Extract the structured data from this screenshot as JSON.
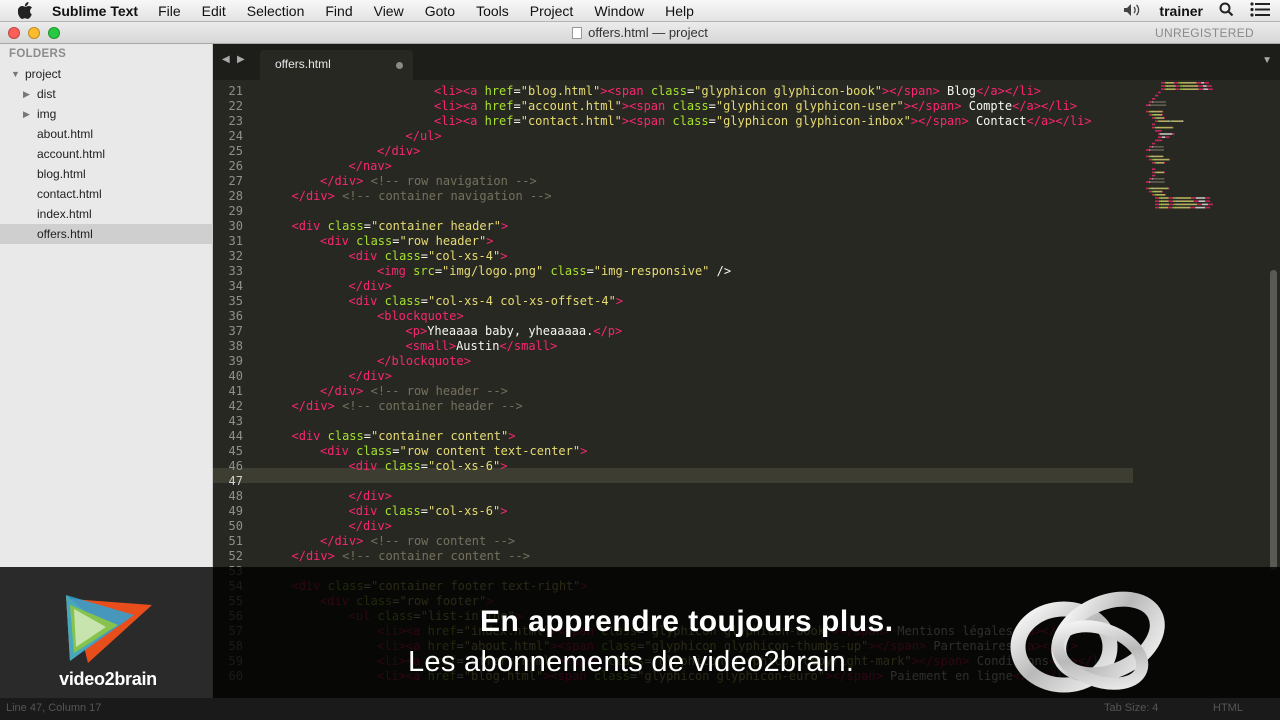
{
  "menubar": {
    "app_name": "Sublime Text",
    "items": [
      "File",
      "Edit",
      "Selection",
      "Find",
      "View",
      "Goto",
      "Tools",
      "Project",
      "Window",
      "Help"
    ],
    "user": "trainer"
  },
  "window": {
    "title": "offers.html — project",
    "registration": "UNREGISTERED"
  },
  "sidebar": {
    "header": "FOLDERS",
    "project": "project",
    "folders": [
      "dist",
      "img"
    ],
    "files": [
      "about.html",
      "account.html",
      "blog.html",
      "contact.html",
      "index.html",
      "offers.html"
    ],
    "selected": "offers.html"
  },
  "tab": {
    "label": "offers.html",
    "modified": true
  },
  "editor": {
    "current_line": 47,
    "lines": [
      {
        "n": 21,
        "indent": 6,
        "p": [
          [
            "t",
            "<li>"
          ],
          [
            "t",
            "<a "
          ],
          [
            "a",
            "href"
          ],
          [
            "p",
            "="
          ],
          [
            "s",
            "\"blog.html\""
          ],
          [
            "t",
            ">"
          ],
          [
            "t",
            "<span "
          ],
          [
            "a",
            "class"
          ],
          [
            "p",
            "="
          ],
          [
            "s",
            "\"glyphicon glyphicon-book\""
          ],
          [
            "t",
            ">"
          ],
          [
            "t",
            "</span>"
          ],
          [
            "p",
            " Blog"
          ],
          [
            "t",
            "</a>"
          ],
          [
            "t",
            "</li>"
          ]
        ]
      },
      {
        "n": 22,
        "indent": 6,
        "p": [
          [
            "t",
            "<li>"
          ],
          [
            "t",
            "<a "
          ],
          [
            "a",
            "href"
          ],
          [
            "p",
            "="
          ],
          [
            "s",
            "\"account.html\""
          ],
          [
            "t",
            ">"
          ],
          [
            "t",
            "<span "
          ],
          [
            "a",
            "class"
          ],
          [
            "p",
            "="
          ],
          [
            "s",
            "\"glyphicon glyphicon-user\""
          ],
          [
            "t",
            ">"
          ],
          [
            "t",
            "</span>"
          ],
          [
            "p",
            " Compte"
          ],
          [
            "t",
            "</a>"
          ],
          [
            "t",
            "</li>"
          ]
        ]
      },
      {
        "n": 23,
        "indent": 6,
        "p": [
          [
            "t",
            "<li>"
          ],
          [
            "t",
            "<a "
          ],
          [
            "a",
            "href"
          ],
          [
            "p",
            "="
          ],
          [
            "s",
            "\"contact.html\""
          ],
          [
            "t",
            ">"
          ],
          [
            "t",
            "<span "
          ],
          [
            "a",
            "class"
          ],
          [
            "p",
            "="
          ],
          [
            "s",
            "\"glyphicon glyphicon-inbox\""
          ],
          [
            "t",
            ">"
          ],
          [
            "t",
            "</span>"
          ],
          [
            "p",
            " Contact"
          ],
          [
            "t",
            "</a>"
          ],
          [
            "t",
            "</li>"
          ]
        ]
      },
      {
        "n": 24,
        "indent": 5,
        "p": [
          [
            "t",
            "</ul>"
          ]
        ]
      },
      {
        "n": 25,
        "indent": 4,
        "p": [
          [
            "t",
            "</div>"
          ]
        ]
      },
      {
        "n": 26,
        "indent": 3,
        "p": [
          [
            "t",
            "</nav>"
          ]
        ]
      },
      {
        "n": 27,
        "indent": 2,
        "p": [
          [
            "t",
            "</div>"
          ],
          [
            "p",
            " "
          ],
          [
            "c",
            "<!-- row navigation -->"
          ]
        ]
      },
      {
        "n": 28,
        "indent": 1,
        "p": [
          [
            "t",
            "</div>"
          ],
          [
            "p",
            " "
          ],
          [
            "c",
            "<!-- container navigation -->"
          ]
        ]
      },
      {
        "n": 29,
        "indent": 0,
        "p": []
      },
      {
        "n": 30,
        "indent": 1,
        "p": [
          [
            "t",
            "<div "
          ],
          [
            "a",
            "class"
          ],
          [
            "p",
            "="
          ],
          [
            "s",
            "\"container header\""
          ],
          [
            "t",
            ">"
          ]
        ]
      },
      {
        "n": 31,
        "indent": 2,
        "p": [
          [
            "t",
            "<div "
          ],
          [
            "a",
            "class"
          ],
          [
            "p",
            "="
          ],
          [
            "s",
            "\"row header\""
          ],
          [
            "t",
            ">"
          ]
        ]
      },
      {
        "n": 32,
        "indent": 3,
        "p": [
          [
            "t",
            "<div "
          ],
          [
            "a",
            "class"
          ],
          [
            "p",
            "="
          ],
          [
            "s",
            "\"col-xs-4\""
          ],
          [
            "t",
            ">"
          ]
        ]
      },
      {
        "n": 33,
        "indent": 4,
        "p": [
          [
            "t",
            "<img "
          ],
          [
            "a",
            "src"
          ],
          [
            "p",
            "="
          ],
          [
            "s",
            "\"img/logo.png\""
          ],
          [
            "p",
            " "
          ],
          [
            "a",
            "class"
          ],
          [
            "p",
            "="
          ],
          [
            "s",
            "\"img-responsive\""
          ],
          [
            "p",
            " />"
          ]
        ]
      },
      {
        "n": 34,
        "indent": 3,
        "p": [
          [
            "t",
            "</div>"
          ]
        ]
      },
      {
        "n": 35,
        "indent": 3,
        "p": [
          [
            "t",
            "<div "
          ],
          [
            "a",
            "class"
          ],
          [
            "p",
            "="
          ],
          [
            "s",
            "\"col-xs-4 col-xs-offset-4\""
          ],
          [
            "t",
            ">"
          ]
        ]
      },
      {
        "n": 36,
        "indent": 4,
        "p": [
          [
            "t",
            "<blockquote>"
          ]
        ]
      },
      {
        "n": 37,
        "indent": 5,
        "p": [
          [
            "t",
            "<p>"
          ],
          [
            "p",
            "Yheaaaa baby, yheaaaaa."
          ],
          [
            "t",
            "</p>"
          ]
        ]
      },
      {
        "n": 38,
        "indent": 5,
        "p": [
          [
            "t",
            "<small>"
          ],
          [
            "p",
            "Austin"
          ],
          [
            "t",
            "</small>"
          ]
        ]
      },
      {
        "n": 39,
        "indent": 4,
        "p": [
          [
            "t",
            "</blockquote>"
          ]
        ]
      },
      {
        "n": 40,
        "indent": 3,
        "p": [
          [
            "t",
            "</div>"
          ]
        ]
      },
      {
        "n": 41,
        "indent": 2,
        "p": [
          [
            "t",
            "</div>"
          ],
          [
            "p",
            " "
          ],
          [
            "c",
            "<!-- row header -->"
          ]
        ]
      },
      {
        "n": 42,
        "indent": 1,
        "p": [
          [
            "t",
            "</div>"
          ],
          [
            "p",
            " "
          ],
          [
            "c",
            "<!-- container header -->"
          ]
        ]
      },
      {
        "n": 43,
        "indent": 0,
        "p": []
      },
      {
        "n": 44,
        "indent": 1,
        "p": [
          [
            "t",
            "<div "
          ],
          [
            "a",
            "class"
          ],
          [
            "p",
            "="
          ],
          [
            "s",
            "\"container content\""
          ],
          [
            "t",
            ">"
          ]
        ]
      },
      {
        "n": 45,
        "indent": 2,
        "p": [
          [
            "t",
            "<div "
          ],
          [
            "a",
            "class"
          ],
          [
            "p",
            "="
          ],
          [
            "s",
            "\"row content text-center\""
          ],
          [
            "t",
            ">"
          ]
        ]
      },
      {
        "n": 46,
        "indent": 3,
        "p": [
          [
            "t",
            "<div "
          ],
          [
            "a",
            "class"
          ],
          [
            "p",
            "="
          ],
          [
            "s",
            "\"col-xs-6\""
          ],
          [
            "t",
            ">"
          ]
        ]
      },
      {
        "n": 47,
        "indent": 0,
        "p": []
      },
      {
        "n": 48,
        "indent": 3,
        "p": [
          [
            "t",
            "</div>"
          ]
        ]
      },
      {
        "n": 49,
        "indent": 3,
        "p": [
          [
            "t",
            "<div "
          ],
          [
            "a",
            "class"
          ],
          [
            "p",
            "="
          ],
          [
            "s",
            "\"col-xs-6\""
          ],
          [
            "t",
            ">"
          ]
        ]
      },
      {
        "n": 50,
        "indent": 3,
        "p": [
          [
            "t",
            "</div>"
          ]
        ]
      },
      {
        "n": 51,
        "indent": 2,
        "p": [
          [
            "t",
            "</div>"
          ],
          [
            "p",
            " "
          ],
          [
            "c",
            "<!-- row content -->"
          ]
        ]
      },
      {
        "n": 52,
        "indent": 1,
        "p": [
          [
            "t",
            "</div>"
          ],
          [
            "p",
            " "
          ],
          [
            "c",
            "<!-- container content -->"
          ]
        ]
      },
      {
        "n": 53,
        "indent": 0,
        "p": []
      },
      {
        "n": 54,
        "indent": 1,
        "p": [
          [
            "t",
            "<div "
          ],
          [
            "a",
            "class"
          ],
          [
            "p",
            "="
          ],
          [
            "s",
            "\"container footer text-right\""
          ],
          [
            "t",
            ">"
          ]
        ]
      },
      {
        "n": 55,
        "indent": 2,
        "p": [
          [
            "t",
            "<div "
          ],
          [
            "a",
            "class"
          ],
          [
            "p",
            "="
          ],
          [
            "s",
            "\"row footer\""
          ],
          [
            "t",
            ">"
          ]
        ]
      },
      {
        "n": 56,
        "indent": 3,
        "p": [
          [
            "t",
            "<ul "
          ],
          [
            "a",
            "class"
          ],
          [
            "p",
            "="
          ],
          [
            "s",
            "\"list-inline\""
          ],
          [
            "t",
            ">"
          ]
        ]
      },
      {
        "n": 57,
        "indent": 4,
        "p": [
          [
            "t",
            "<li>"
          ],
          [
            "t",
            "<a "
          ],
          [
            "a",
            "href"
          ],
          [
            "p",
            "="
          ],
          [
            "s",
            "\"index.html\""
          ],
          [
            "t",
            ">"
          ],
          [
            "t",
            "<span "
          ],
          [
            "a",
            "class"
          ],
          [
            "p",
            "="
          ],
          [
            "s",
            "\"glyphicon glyphicon-book\""
          ],
          [
            "t",
            ">"
          ],
          [
            "t",
            "</span>"
          ],
          [
            "p",
            " Mentions légales"
          ],
          [
            "t",
            "</a>"
          ],
          [
            "t",
            "</li>"
          ]
        ]
      },
      {
        "n": 58,
        "indent": 4,
        "p": [
          [
            "t",
            "<li>"
          ],
          [
            "t",
            "<a "
          ],
          [
            "a",
            "href"
          ],
          [
            "p",
            "="
          ],
          [
            "s",
            "\"about.html\""
          ],
          [
            "t",
            ">"
          ],
          [
            "t",
            "<span "
          ],
          [
            "a",
            "class"
          ],
          [
            "p",
            "="
          ],
          [
            "s",
            "\"glyphicon glyphicon-thumbs-up\""
          ],
          [
            "t",
            ">"
          ],
          [
            "t",
            "</span>"
          ],
          [
            "p",
            " Partenaires"
          ],
          [
            "t",
            "</a>"
          ],
          [
            "t",
            "</li>"
          ]
        ]
      },
      {
        "n": 59,
        "indent": 4,
        "p": [
          [
            "t",
            "<li>"
          ],
          [
            "t",
            "<a "
          ],
          [
            "a",
            "href"
          ],
          [
            "p",
            "="
          ],
          [
            "s",
            "\"offers.html\""
          ],
          [
            "t",
            ">"
          ],
          [
            "t",
            "<span "
          ],
          [
            "a",
            "class"
          ],
          [
            "p",
            "="
          ],
          [
            "s",
            "\"glyphicon glyphicon-copyright-mark\""
          ],
          [
            "t",
            ">"
          ],
          [
            "t",
            "</span>"
          ],
          [
            "p",
            " Conditions"
          ],
          [
            "t",
            "</a>"
          ],
          [
            "t",
            "</li>"
          ]
        ]
      },
      {
        "n": 60,
        "indent": 4,
        "p": [
          [
            "t",
            "<li>"
          ],
          [
            "t",
            "<a "
          ],
          [
            "a",
            "href"
          ],
          [
            "p",
            "="
          ],
          [
            "s",
            "\"blog.html\""
          ],
          [
            "t",
            ">"
          ],
          [
            "t",
            "<span "
          ],
          [
            "a",
            "class"
          ],
          [
            "p",
            "="
          ],
          [
            "s",
            "\"glyphicon glyphicon-euro\""
          ],
          [
            "t",
            ">"
          ],
          [
            "t",
            "</span>"
          ],
          [
            "p",
            " Paiement en ligne"
          ],
          [
            "t",
            "</a>"
          ],
          [
            "t",
            "</li>"
          ]
        ]
      }
    ]
  },
  "statusbar": {
    "position": "Line 47, Column 17",
    "tab_size": "Tab Size: 4",
    "syntax": "HTML"
  },
  "banner": {
    "brand": "video2brain",
    "tagline_1": "En apprendre toujours plus.",
    "tagline_2": "Les abonnements de video2brain."
  },
  "colors": {
    "editor_bg": "#272822",
    "tag": "#f92672",
    "attribute": "#a6e22e",
    "string": "#e6db74",
    "comment": "#75715e",
    "text": "#f8f8f2"
  }
}
